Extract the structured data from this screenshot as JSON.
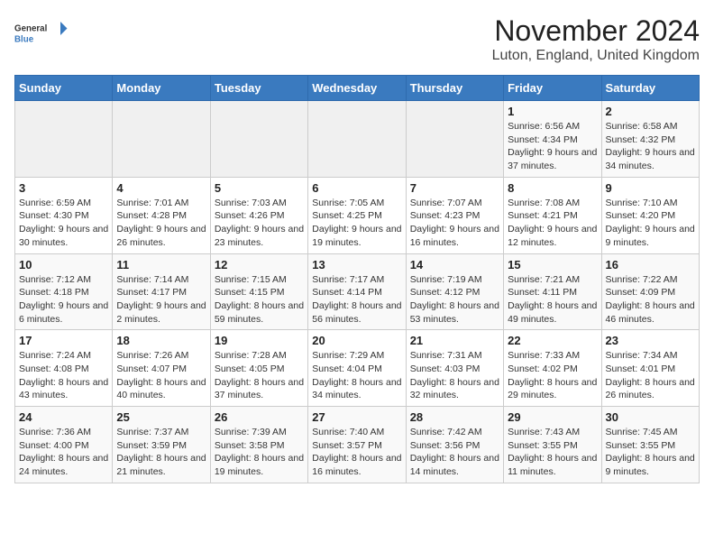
{
  "app": {
    "name_general": "General",
    "name_blue": "Blue"
  },
  "title": "November 2024",
  "subtitle": "Luton, England, United Kingdom",
  "days_of_week": [
    "Sunday",
    "Monday",
    "Tuesday",
    "Wednesday",
    "Thursday",
    "Friday",
    "Saturday"
  ],
  "weeks": [
    [
      {
        "day": "",
        "info": ""
      },
      {
        "day": "",
        "info": ""
      },
      {
        "day": "",
        "info": ""
      },
      {
        "day": "",
        "info": ""
      },
      {
        "day": "",
        "info": ""
      },
      {
        "day": "1",
        "info": "Sunrise: 6:56 AM\nSunset: 4:34 PM\nDaylight: 9 hours and 37 minutes."
      },
      {
        "day": "2",
        "info": "Sunrise: 6:58 AM\nSunset: 4:32 PM\nDaylight: 9 hours and 34 minutes."
      }
    ],
    [
      {
        "day": "3",
        "info": "Sunrise: 6:59 AM\nSunset: 4:30 PM\nDaylight: 9 hours and 30 minutes."
      },
      {
        "day": "4",
        "info": "Sunrise: 7:01 AM\nSunset: 4:28 PM\nDaylight: 9 hours and 26 minutes."
      },
      {
        "day": "5",
        "info": "Sunrise: 7:03 AM\nSunset: 4:26 PM\nDaylight: 9 hours and 23 minutes."
      },
      {
        "day": "6",
        "info": "Sunrise: 7:05 AM\nSunset: 4:25 PM\nDaylight: 9 hours and 19 minutes."
      },
      {
        "day": "7",
        "info": "Sunrise: 7:07 AM\nSunset: 4:23 PM\nDaylight: 9 hours and 16 minutes."
      },
      {
        "day": "8",
        "info": "Sunrise: 7:08 AM\nSunset: 4:21 PM\nDaylight: 9 hours and 12 minutes."
      },
      {
        "day": "9",
        "info": "Sunrise: 7:10 AM\nSunset: 4:20 PM\nDaylight: 9 hours and 9 minutes."
      }
    ],
    [
      {
        "day": "10",
        "info": "Sunrise: 7:12 AM\nSunset: 4:18 PM\nDaylight: 9 hours and 6 minutes."
      },
      {
        "day": "11",
        "info": "Sunrise: 7:14 AM\nSunset: 4:17 PM\nDaylight: 9 hours and 2 minutes."
      },
      {
        "day": "12",
        "info": "Sunrise: 7:15 AM\nSunset: 4:15 PM\nDaylight: 8 hours and 59 minutes."
      },
      {
        "day": "13",
        "info": "Sunrise: 7:17 AM\nSunset: 4:14 PM\nDaylight: 8 hours and 56 minutes."
      },
      {
        "day": "14",
        "info": "Sunrise: 7:19 AM\nSunset: 4:12 PM\nDaylight: 8 hours and 53 minutes."
      },
      {
        "day": "15",
        "info": "Sunrise: 7:21 AM\nSunset: 4:11 PM\nDaylight: 8 hours and 49 minutes."
      },
      {
        "day": "16",
        "info": "Sunrise: 7:22 AM\nSunset: 4:09 PM\nDaylight: 8 hours and 46 minutes."
      }
    ],
    [
      {
        "day": "17",
        "info": "Sunrise: 7:24 AM\nSunset: 4:08 PM\nDaylight: 8 hours and 43 minutes."
      },
      {
        "day": "18",
        "info": "Sunrise: 7:26 AM\nSunset: 4:07 PM\nDaylight: 8 hours and 40 minutes."
      },
      {
        "day": "19",
        "info": "Sunrise: 7:28 AM\nSunset: 4:05 PM\nDaylight: 8 hours and 37 minutes."
      },
      {
        "day": "20",
        "info": "Sunrise: 7:29 AM\nSunset: 4:04 PM\nDaylight: 8 hours and 34 minutes."
      },
      {
        "day": "21",
        "info": "Sunrise: 7:31 AM\nSunset: 4:03 PM\nDaylight: 8 hours and 32 minutes."
      },
      {
        "day": "22",
        "info": "Sunrise: 7:33 AM\nSunset: 4:02 PM\nDaylight: 8 hours and 29 minutes."
      },
      {
        "day": "23",
        "info": "Sunrise: 7:34 AM\nSunset: 4:01 PM\nDaylight: 8 hours and 26 minutes."
      }
    ],
    [
      {
        "day": "24",
        "info": "Sunrise: 7:36 AM\nSunset: 4:00 PM\nDaylight: 8 hours and 24 minutes."
      },
      {
        "day": "25",
        "info": "Sunrise: 7:37 AM\nSunset: 3:59 PM\nDaylight: 8 hours and 21 minutes."
      },
      {
        "day": "26",
        "info": "Sunrise: 7:39 AM\nSunset: 3:58 PM\nDaylight: 8 hours and 19 minutes."
      },
      {
        "day": "27",
        "info": "Sunrise: 7:40 AM\nSunset: 3:57 PM\nDaylight: 8 hours and 16 minutes."
      },
      {
        "day": "28",
        "info": "Sunrise: 7:42 AM\nSunset: 3:56 PM\nDaylight: 8 hours and 14 minutes."
      },
      {
        "day": "29",
        "info": "Sunrise: 7:43 AM\nSunset: 3:55 PM\nDaylight: 8 hours and 11 minutes."
      },
      {
        "day": "30",
        "info": "Sunrise: 7:45 AM\nSunset: 3:55 PM\nDaylight: 8 hours and 9 minutes."
      }
    ]
  ]
}
